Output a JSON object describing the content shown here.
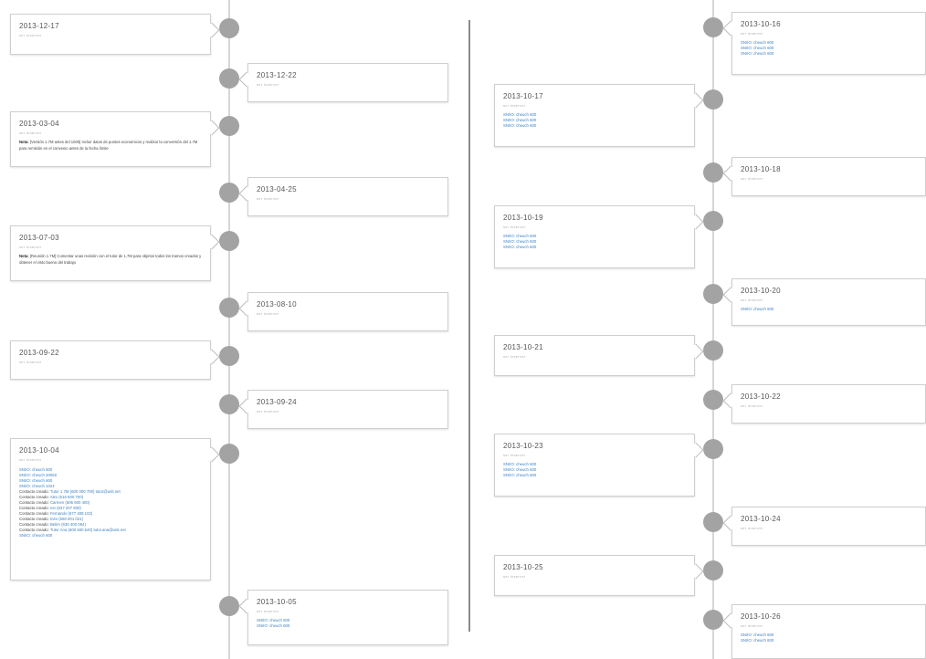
{
  "entries": {
    "e1": {
      "date": "2013-12-17",
      "sub": "ser inserver"
    },
    "e2": {
      "date": "2013-12-22",
      "sub": "ser inserver"
    },
    "e3": {
      "date": "2013-03-04",
      "sub": "ser inserver",
      "note_label": "Nota:",
      "note_text": "[Versión 1.7M antes del 1000] Incluir datos de puntos economicos y realizar la conversión del 1.7M para remisión en el convenio antes de la fecha límite"
    },
    "e4": {
      "date": "2013-04-25",
      "sub": "ser inserver"
    },
    "e5": {
      "date": "2013-07-03",
      "sub": "ser inserver",
      "note_label": "Nota:",
      "note_text": "[Reunión 1.7M] Comentar unas revisión con el tutor de 1.7M para objetos todos los tramos creados y obtener el visto bueno del trabajo"
    },
    "e6": {
      "date": "2013-08-10",
      "sub": "ser inserver"
    },
    "e7": {
      "date": "2013-09-22",
      "sub": "ser inserver"
    },
    "e8": {
      "date": "2013-09-24",
      "sub": "ser inserver"
    },
    "e9": {
      "date": "2013-10-04",
      "sub": "ser inserver",
      "links": [
        "SN/IO: cheuch 600",
        "SN/IO: cheuch 20050",
        "SN/IO: cheuch 600",
        "SN/IO: cheuch 1024"
      ],
      "contact_label": "Contacto creado:",
      "contacts": [
        "Tutor 1.7M (600 000 700) tutor@unit.net",
        "Alex (616 600 700)",
        "Carmen (606 600 400)",
        "Ion (637 207 600)",
        "Fernando (677 408 102)",
        "Inés (660 001 021)",
        "Belén (630 400 084)",
        "Tutor Ana (600 600 620) tutor.ana@unit.net"
      ],
      "last_link": "SN/IO: cheuch 600"
    },
    "e10": {
      "date": "2013-10-05",
      "sub": "ser inserver",
      "links": [
        "SN/IO: cheuch 600",
        "SN/IO: cheuch 600"
      ]
    },
    "e11": {
      "date": "2013-10-16",
      "sub": "ser inserver",
      "links": [
        "SN/IO: cheuch 600",
        "SN/IO: cheuch 600",
        "SN/IO: cheuch 600"
      ]
    },
    "e12": {
      "date": "2013-10-17",
      "sub": "ser inserver",
      "links": [
        "SN/IO: cheuch 600",
        "SN/IO: cheuch 600",
        "SN/IO: cheuch 600"
      ]
    },
    "e13": {
      "date": "2013-10-18",
      "sub": "ser inserver"
    },
    "e14": {
      "date": "2013-10-19",
      "sub": "ser inserver",
      "links": [
        "SN/IO: cheuch 600",
        "SN/IO: cheuch 600",
        "SN/IO: cheuch 600"
      ]
    },
    "e15": {
      "date": "2013-10-20",
      "sub": "ser inserver",
      "links": [
        "SN/IO: cheuch 600"
      ]
    },
    "e16": {
      "date": "2013-10-21",
      "sub": "ser inserver"
    },
    "e17": {
      "date": "2013-10-22",
      "sub": "ser inserver"
    },
    "e18": {
      "date": "2013-10-23",
      "sub": "ser inserver",
      "links": [
        "SN/IO: cheuch 600",
        "SN/IO: cheuch 600",
        "SN/IO: cheuch 600"
      ]
    },
    "e19": {
      "date": "2013-10-24",
      "sub": "ser inserver"
    },
    "e20": {
      "date": "2013-10-25",
      "sub": "ser inserver"
    },
    "e21": {
      "date": "2013-10-26",
      "sub": "ser inserver",
      "links": [
        "SN/IO: cheuch 600",
        "SN/IO: cheuch 600"
      ]
    }
  },
  "colors": {
    "dot": "#a3a3a3",
    "link": "#3a7fc2",
    "axis": "#d6d6d6",
    "divider": "#8c8c8c"
  }
}
